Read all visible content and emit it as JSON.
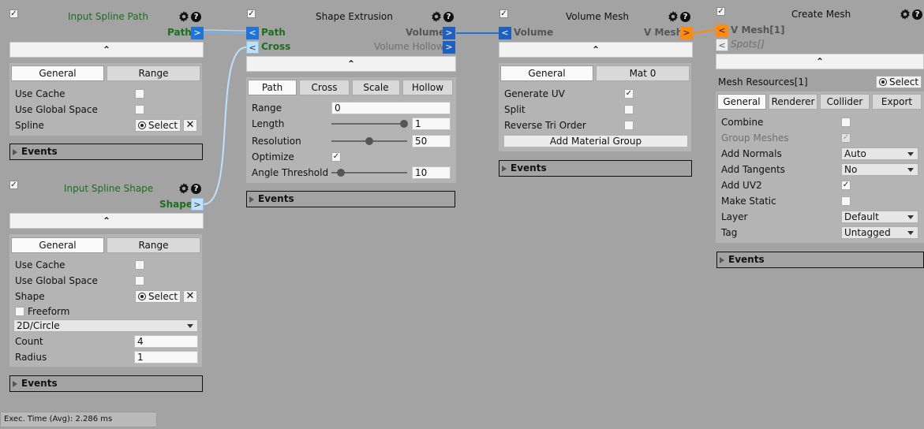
{
  "common": {
    "select_label": "Select",
    "close_glyph": "✕",
    "check_glyph": "✓",
    "collapse_glyph": "⌃",
    "events_label": "Events",
    "help_glyph": "?"
  },
  "input_path": {
    "title": "Input Spline Path",
    "out_port_label": "Path",
    "out_port_glyph": ">",
    "tabs": [
      "General",
      "Range"
    ],
    "props": [
      "Use Cache",
      "Use Global Space",
      "Spline"
    ]
  },
  "input_shape": {
    "title": "Input Spline Shape",
    "out_port_label": "Shape",
    "out_port_glyph": ">",
    "tabs": [
      "General",
      "Range"
    ],
    "props": [
      "Use Cache",
      "Use Global Space",
      "Shape"
    ],
    "freeform_label": "Freeform",
    "shape_type": "2D/Circle",
    "count_label": "Count",
    "count_value": "4",
    "radius_label": "Radius",
    "radius_value": "1"
  },
  "extrusion": {
    "title": "Shape Extrusion",
    "in_ports": [
      {
        "glyph": "<",
        "label": "Path"
      },
      {
        "glyph": "<",
        "label": "Cross"
      }
    ],
    "out_ports": [
      {
        "glyph": ">",
        "label": "Volume"
      },
      {
        "glyph": ">",
        "label": "Volume Hollow"
      }
    ],
    "tabs": [
      "Path",
      "Cross",
      "Scale",
      "Hollow"
    ],
    "range_label": "Range",
    "range_value": "0",
    "length_label": "Length",
    "length_value": "1",
    "resolution_label": "Resolution",
    "resolution_value": "50",
    "optimize_label": "Optimize",
    "angle_label": "Angle Threshold",
    "angle_value": "10"
  },
  "volume_mesh": {
    "title": "Volume Mesh",
    "in_port": {
      "glyph": "<",
      "label": "Volume"
    },
    "out_port": {
      "glyph": ">",
      "label": "V Mesh"
    },
    "tabs": [
      "General",
      "Mat 0"
    ],
    "props": [
      "Generate UV",
      "Split",
      "Reverse Tri Order"
    ],
    "add_material_group": "Add Material Group"
  },
  "create_mesh": {
    "title": "Create Mesh",
    "in_ports": [
      {
        "glyph": "<",
        "label": "V Mesh[1]"
      },
      {
        "glyph": "<",
        "label": "Spots[]"
      }
    ],
    "resources_label": "Mesh Resources[1]",
    "tabs": [
      "General",
      "Renderer",
      "Collider",
      "Export"
    ],
    "props": [
      "Combine",
      "Group Meshes",
      "Add Normals",
      "Add Tangents",
      "Add UV2",
      "Make Static",
      "Layer",
      "Tag"
    ],
    "add_normals_value": "Auto",
    "add_tangents_value": "No",
    "layer_value": "Default",
    "tag_value": "Untagged"
  },
  "status_bar": {
    "exec_time": "Exec. Time (Avg): 2.286 ms"
  }
}
